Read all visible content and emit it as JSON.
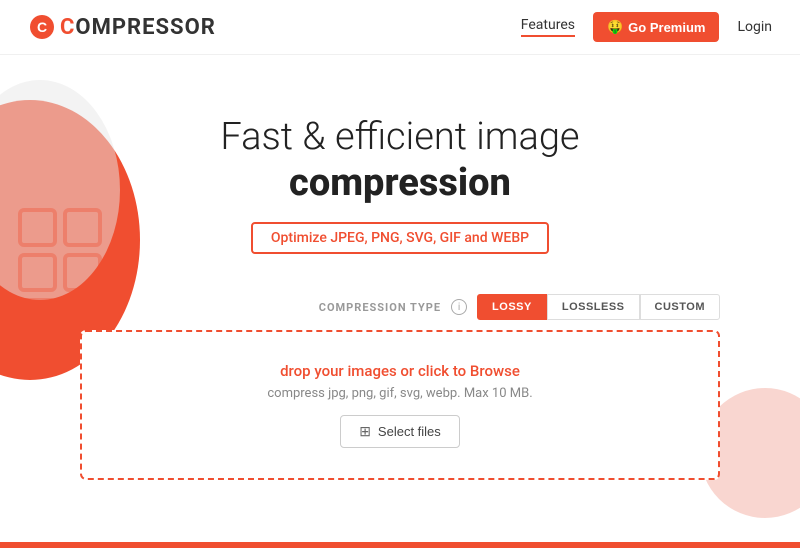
{
  "brand": {
    "name_prefix": "C",
    "name_rest": "OMPRESSOR",
    "logo_letter": "C"
  },
  "nav": {
    "features_label": "Features",
    "premium_label": "Go Premium",
    "premium_emoji": "🤑",
    "login_label": "Login"
  },
  "hero": {
    "title_line1": "Fast & efficient image",
    "title_line2": "compression",
    "subtitle": "Optimize JPEG, PNG, SVG, GIF and WEBP"
  },
  "compression": {
    "type_label": "COMPRESSION TYPE",
    "info_char": "i",
    "types": [
      {
        "id": "lossy",
        "label": "LOSSY",
        "active": true
      },
      {
        "id": "lossless",
        "label": "LOSSLESS",
        "active": false
      },
      {
        "id": "custom",
        "label": "CUSTOM",
        "active": false
      }
    ]
  },
  "dropzone": {
    "main_text": "drop your images or click to Browse",
    "sub_text": "compress jpg, png, gif, svg, webp. Max 10 MB.",
    "select_btn_label": "Select files",
    "select_icon": "⊞"
  }
}
